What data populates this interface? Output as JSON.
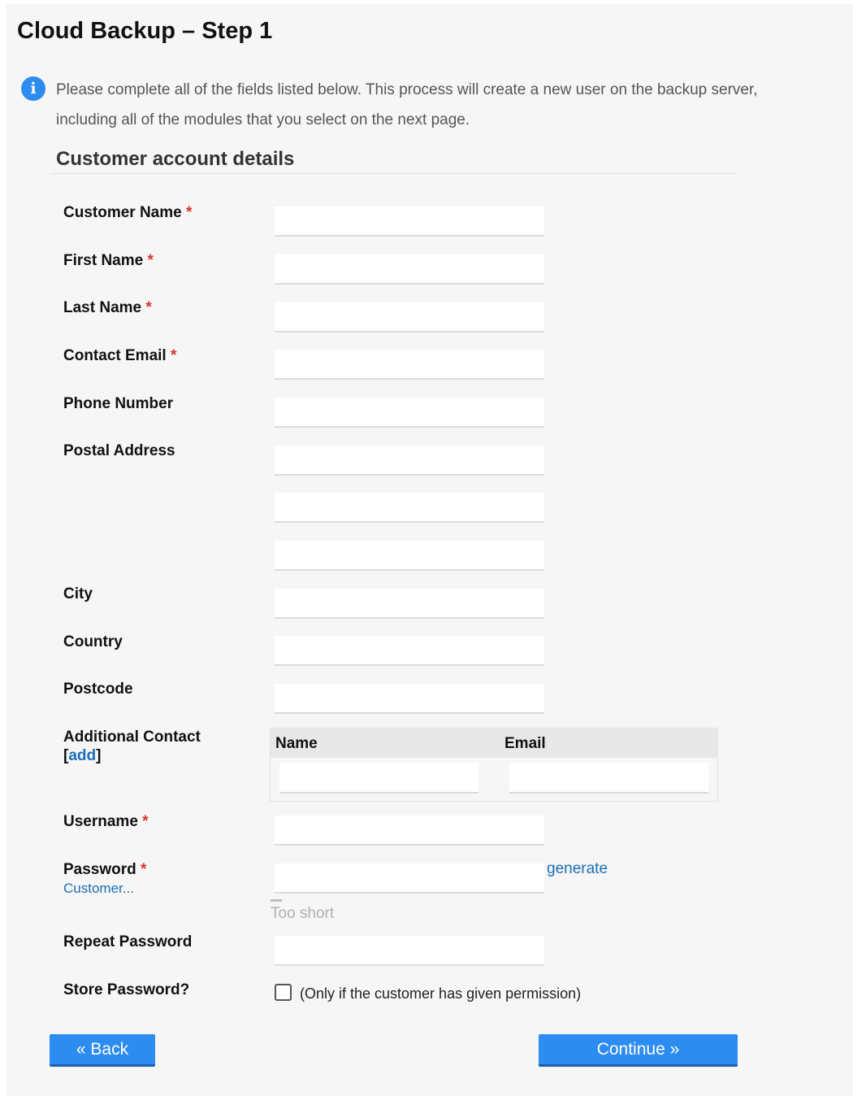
{
  "page": {
    "title": "Cloud Backup – Step 1",
    "info_icon": "info-icon",
    "info_text": "Please complete all of the fields listed below. This process will create a new user on the backup server, including all of the modules that you select on the next page.",
    "section_title": "Customer account details",
    "required_mark": "*"
  },
  "form": {
    "customer_name_label": "Customer Name",
    "customer_name_value": "",
    "first_name_label": "First Name",
    "first_name_value": "",
    "last_name_label": "Last Name",
    "last_name_value": "",
    "contact_email_label": "Contact Email",
    "contact_email_value": "",
    "phone_label": "Phone Number",
    "phone_value": "",
    "postal_address_label": "Postal Address",
    "postal_address_lines": [
      "",
      "",
      ""
    ],
    "city_label": "City",
    "city_value": "",
    "country_label": "Country",
    "country_value": "",
    "postcode_label": "Postcode",
    "postcode_value": "",
    "additional_contact": {
      "label": "Additional Contact",
      "bracket_open": "[",
      "add_link": "add",
      "bracket_close": "]",
      "columns": [
        "Name",
        "Email"
      ],
      "rows": [
        {
          "name": "",
          "email": ""
        }
      ]
    },
    "username_label": "Username",
    "username_value": "",
    "password_label": "Password",
    "password_value": "",
    "password_hint_link": "Customer...",
    "generate_link": "generate",
    "password_strength": "Too short",
    "repeat_password_label": "Repeat Password",
    "repeat_password_value": "",
    "store_password_label": "Store Password?",
    "store_password_checked": false,
    "store_password_note": "(Only if the customer has given permission)"
  },
  "buttons": {
    "back_label": "« Back",
    "continue_label": "Continue »"
  },
  "colors": {
    "accent": "#2d8cf0",
    "link": "#1a6fb5",
    "required": "#d9342b",
    "panel_background": "#f6f6f6"
  }
}
